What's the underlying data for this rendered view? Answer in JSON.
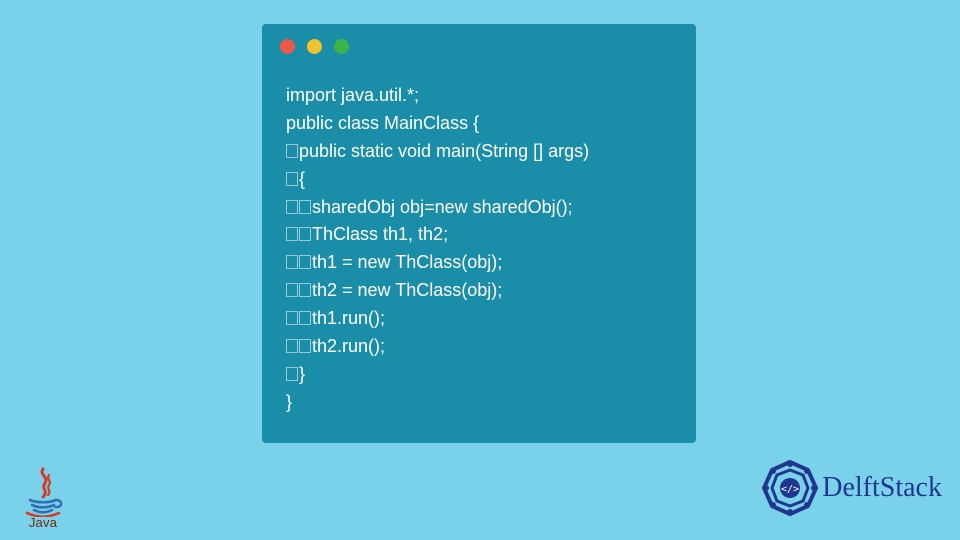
{
  "colors": {
    "background": "#7ad1ea",
    "window": "#1a8da8",
    "dot_red": "#ec5a47",
    "dot_yellow": "#f0c22d",
    "dot_green": "#3bb44a",
    "java_steam": "#d73a27",
    "java_cup": "#2f6fb2",
    "java_text": "#6b2b10",
    "delft_blue": "#21378f"
  },
  "code": {
    "lines": [
      {
        "indent": 0,
        "text": "import java.util.*;"
      },
      {
        "indent": 0,
        "text": "public class MainClass {"
      },
      {
        "indent": 1,
        "text": "public static void main(String [] args)"
      },
      {
        "indent": 1,
        "text": "{"
      },
      {
        "indent": 2,
        "text": "sharedObj obj=new sharedObj();"
      },
      {
        "indent": 2,
        "text": "ThClass th1, th2;"
      },
      {
        "indent": 2,
        "text": "th1 = new ThClass(obj);"
      },
      {
        "indent": 2,
        "text": "th2 = new ThClass(obj);"
      },
      {
        "indent": 2,
        "text": "th1.run();"
      },
      {
        "indent": 2,
        "text": "th2.run();"
      },
      {
        "indent": 1,
        "text": "}"
      },
      {
        "indent": 0,
        "text": "}"
      }
    ]
  },
  "logos": {
    "java_label": "Java",
    "delftstack_label": "DelftStack"
  }
}
